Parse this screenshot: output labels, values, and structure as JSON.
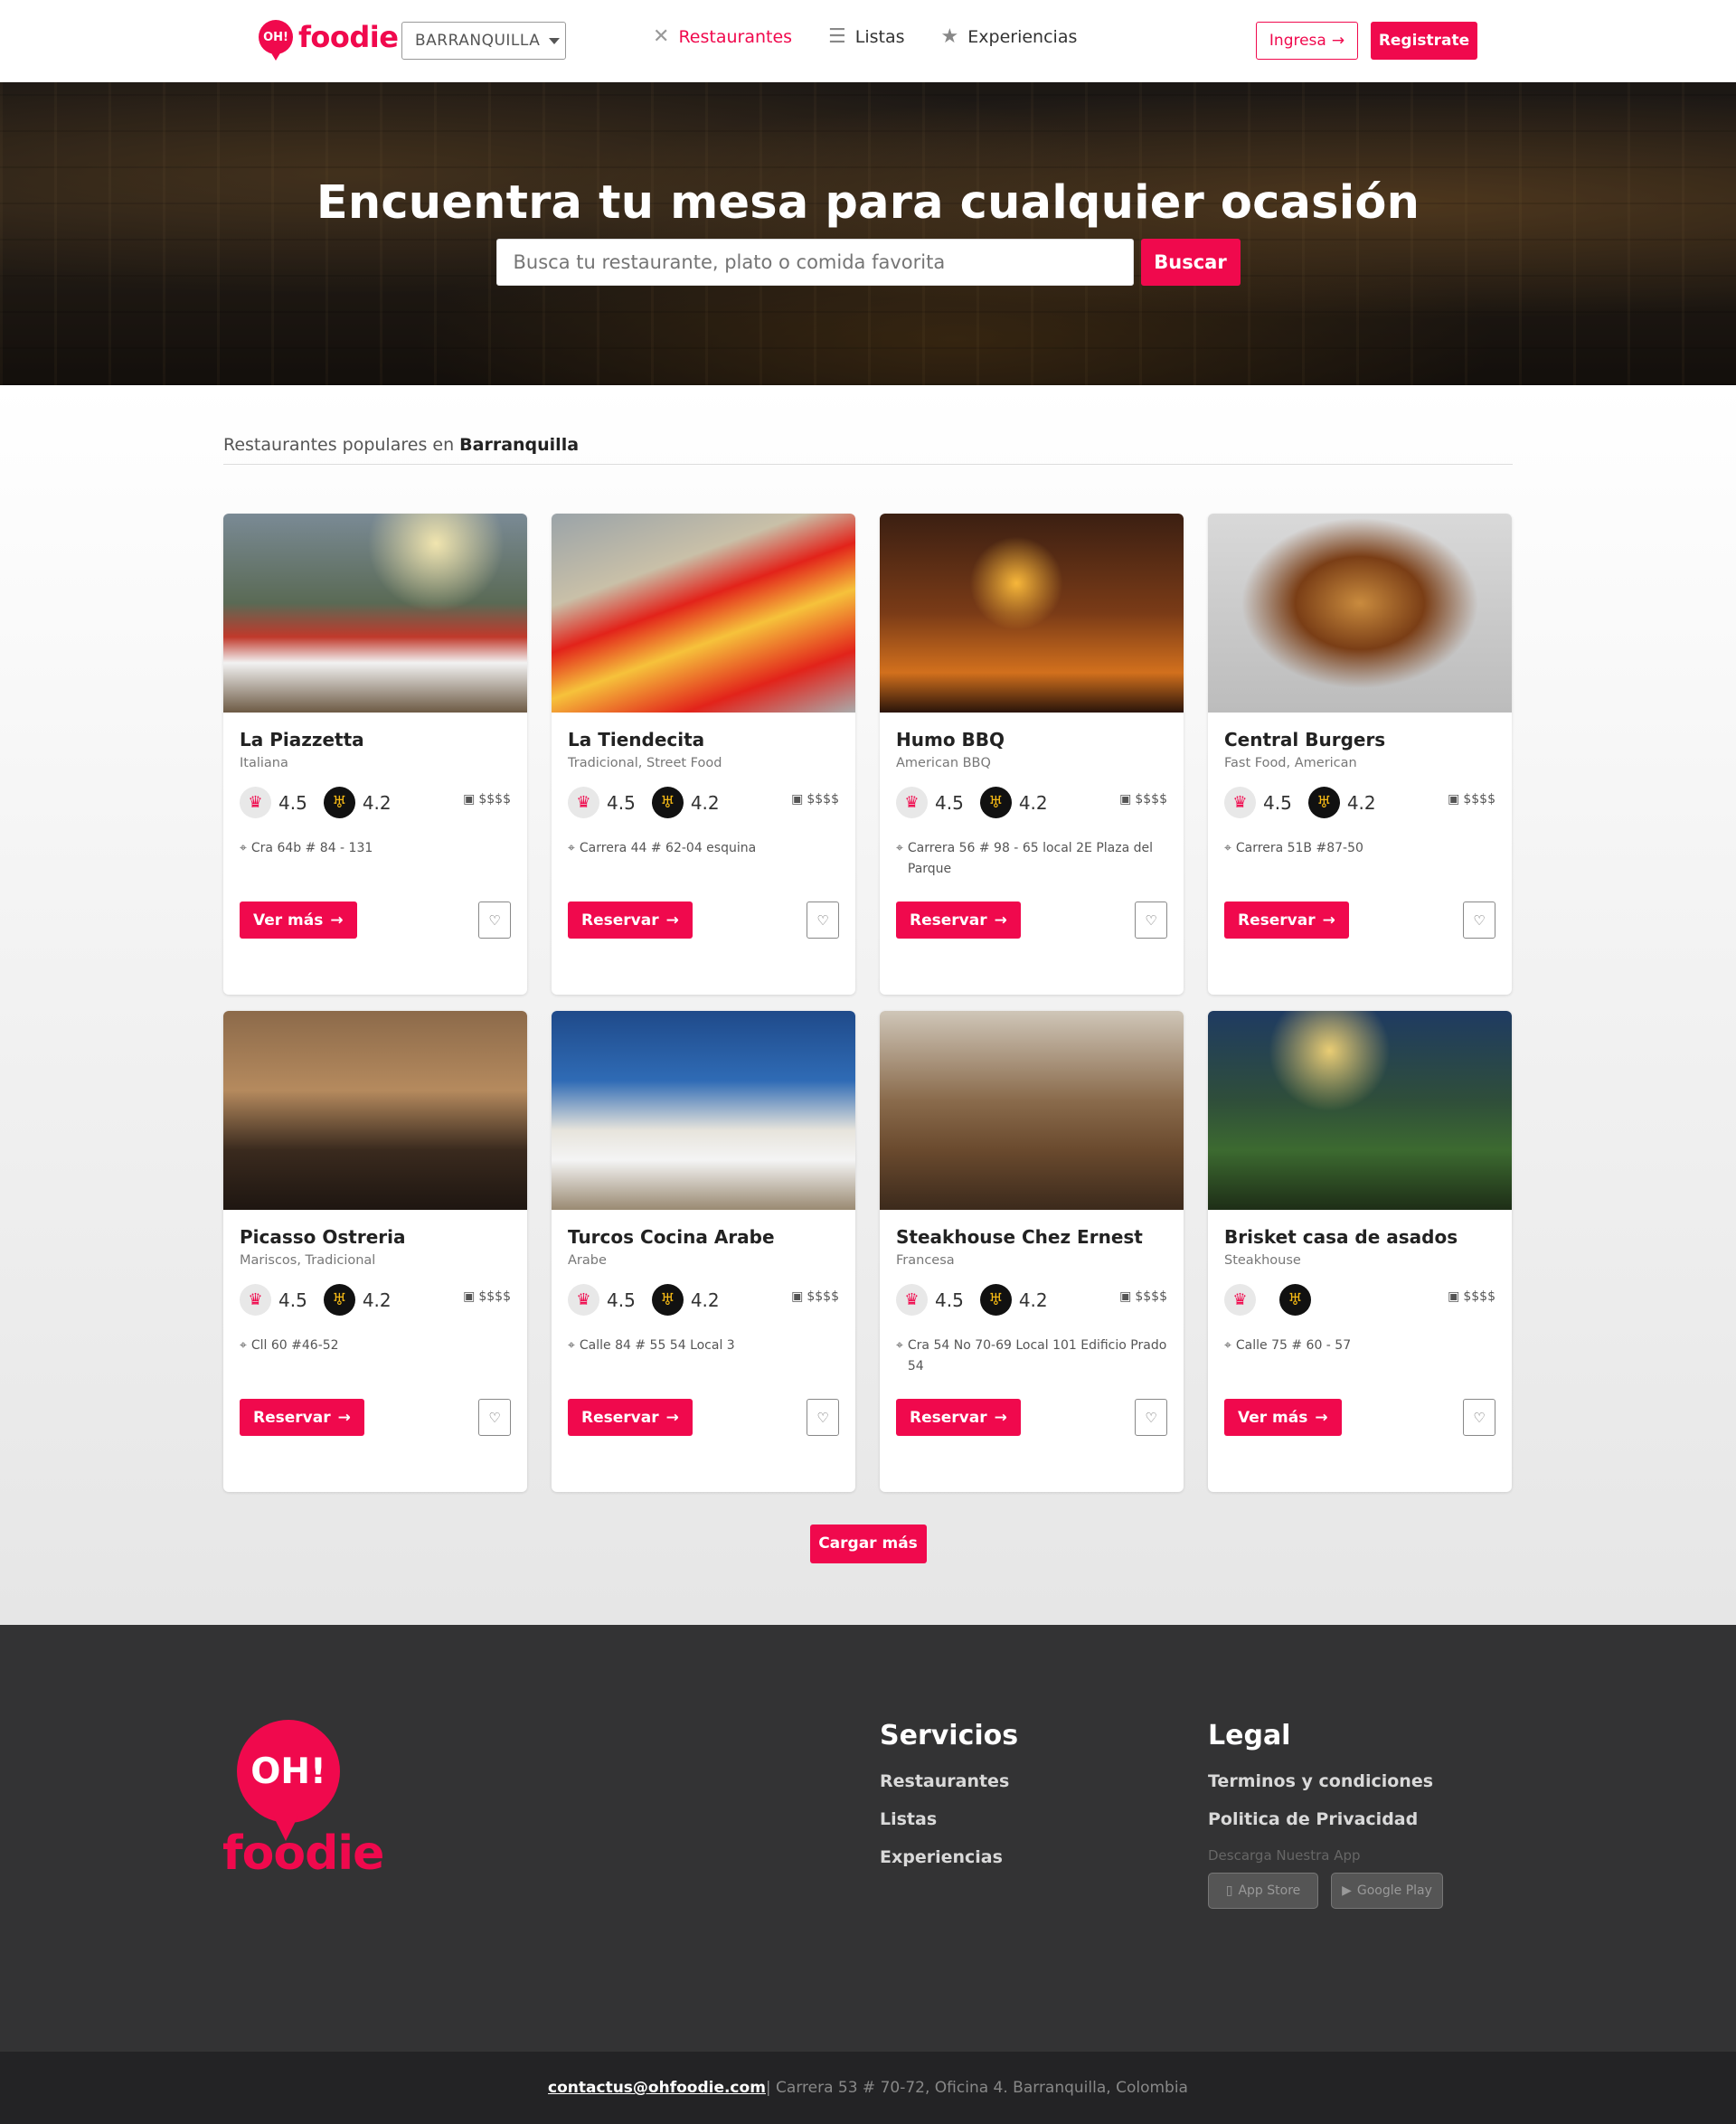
{
  "header": {
    "logo_badge": "OH!",
    "logo_word": "foodie",
    "city": "BARRANQUILLA",
    "nav": [
      {
        "label": "Restaurantes",
        "icon": "fork-knife-icon"
      },
      {
        "label": "Listas",
        "icon": "list-icon"
      },
      {
        "label": "Experiencias",
        "icon": "star-icon"
      }
    ],
    "login_label": "Ingresa",
    "register_label": "Registrate"
  },
  "hero": {
    "title": "Encuentra tu mesa para cualquier ocasión",
    "search_placeholder": "Busca tu restaurante, plato o comida favorita",
    "search_button": "Buscar"
  },
  "section": {
    "prefix": "Restaurantes populares en",
    "city": "Barranquilla"
  },
  "restaurants": [
    {
      "name": "La Piazzetta",
      "cats": "Italiana",
      "chef": "4.5",
      "cup": "4.2",
      "price": "$$$$",
      "address": "Cra 64b # 84 - 131",
      "button": "Ver más"
    },
    {
      "name": "La Tiendecita",
      "cats": "Tradicional, Street Food",
      "chef": "4.5",
      "cup": "4.2",
      "price": "$$$$",
      "address": "Carrera 44 # 62-04 esquina",
      "button": "Reservar"
    },
    {
      "name": "Humo BBQ",
      "cats": "American BBQ",
      "chef": "4.5",
      "cup": "4.2",
      "price": "$$$$",
      "address": "Carrera 56 # 98 - 65 local 2E Plaza del Parque",
      "button": "Reservar"
    },
    {
      "name": "Central Burgers",
      "cats": "Fast Food, American",
      "chef": "4.5",
      "cup": "4.2",
      "price": "$$$$",
      "address": "Carrera 51B #87-50",
      "button": "Reservar"
    },
    {
      "name": "Picasso Ostreria",
      "cats": "Mariscos, Tradicional",
      "chef": "4.5",
      "cup": "4.2",
      "price": "$$$$",
      "address": "Cll 60 #46-52",
      "button": "Reservar"
    },
    {
      "name": "Turcos Cocina Arabe",
      "cats": "Arabe",
      "chef": "4.5",
      "cup": "4.2",
      "price": "$$$$",
      "address": "Calle 84 # 55 54 Local 3",
      "button": "Reservar"
    },
    {
      "name": "Steakhouse Chez Ernest",
      "cats": "Francesa",
      "chef": "4.5",
      "cup": "4.2",
      "price": "$$$$",
      "address": "Cra 54 No 70-69 Local 101 Edificio Prado 54",
      "button": "Reservar"
    },
    {
      "name": "Brisket casa de asados",
      "cats": "Steakhouse",
      "chef": "",
      "cup": "",
      "price": "$$$$",
      "address": "Calle 75 # 60 - 57",
      "button": "Ver más"
    }
  ],
  "load_more": "Cargar más",
  "footer": {
    "logo_badge": "OH!",
    "logo_word": "foodie",
    "services_title": "Servicios",
    "services": [
      "Restaurantes",
      "Listas",
      "Experiencias"
    ],
    "legal_title": "Legal",
    "legal": [
      "Terminos y condiciones",
      "Politica de Privacidad"
    ],
    "app_label": "Descarga Nuestra App",
    "app_store": "App Store",
    "google_play": "Google Play",
    "email": "contactus@ohfoodie.com",
    "address": " | Carrera 53 # 70-72, Oficina 4. Barranquilla, Colombia"
  },
  "colors": {
    "brand": "#f0094d",
    "footer_bg": "#333334",
    "bottom_bar_bg": "#232325"
  }
}
